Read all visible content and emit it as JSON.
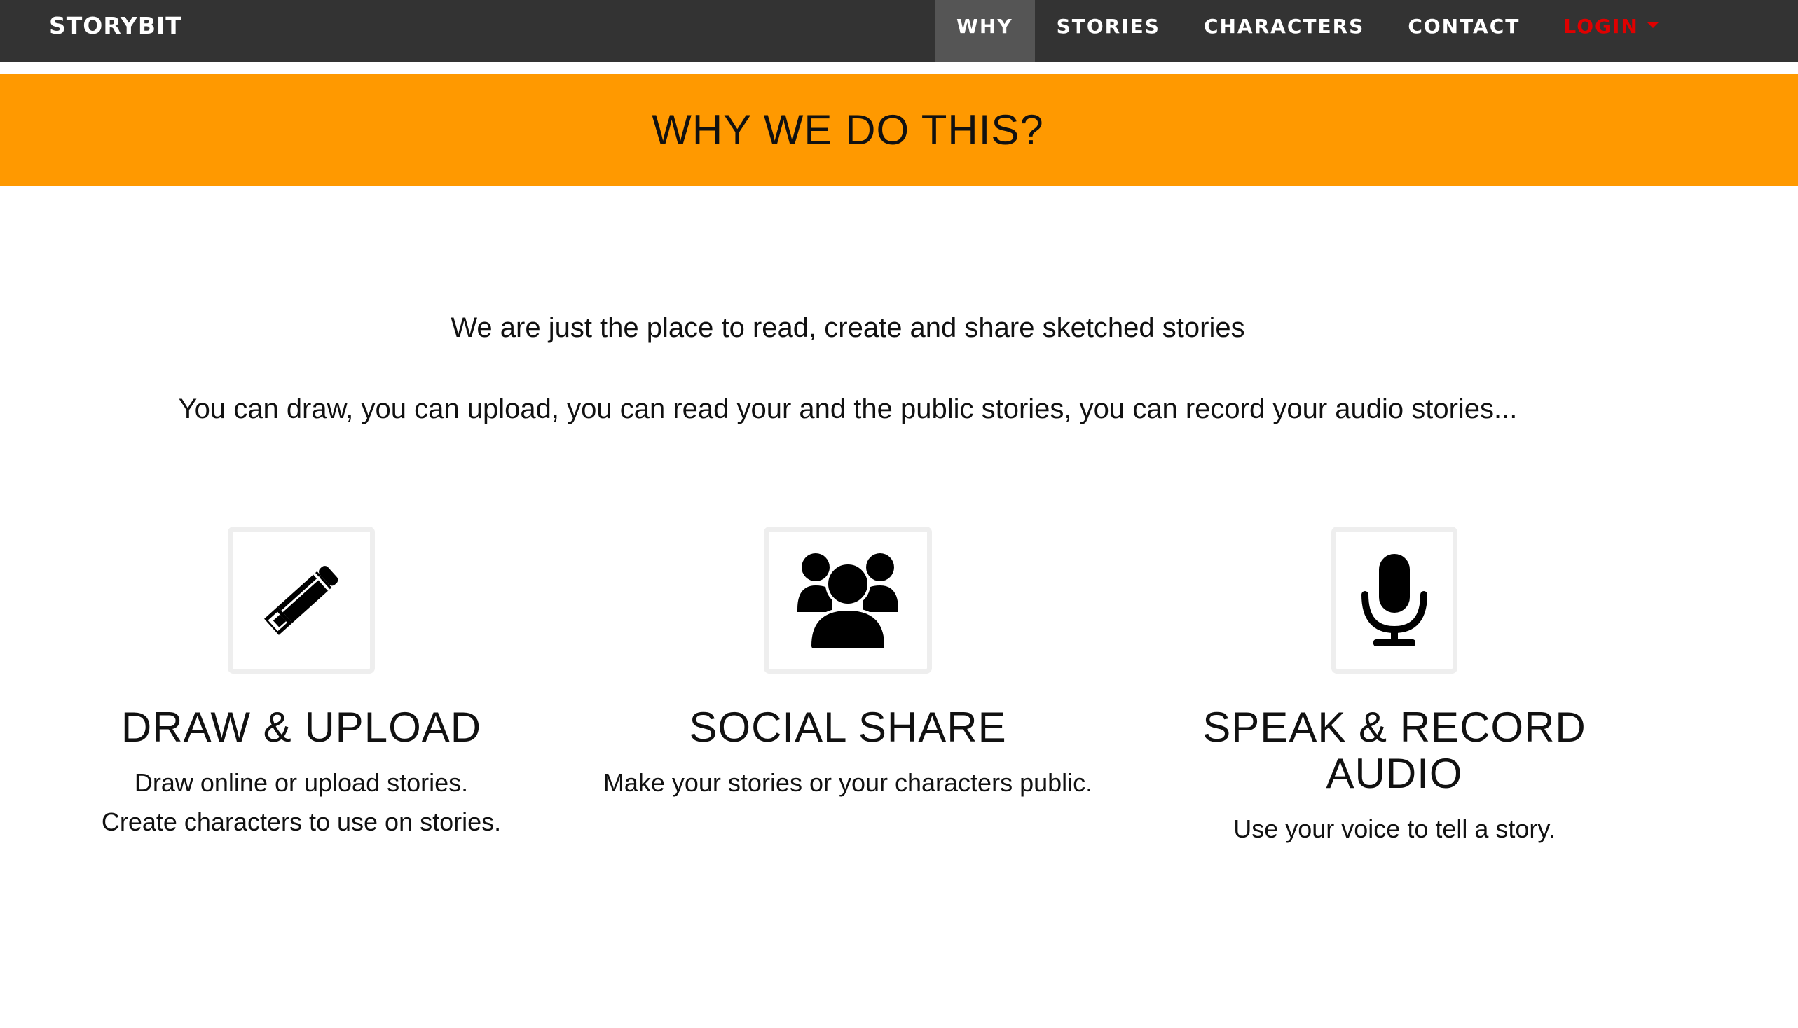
{
  "navbar": {
    "brand": "STORYBIT",
    "items": [
      {
        "label": "WHY",
        "active": true
      },
      {
        "label": "STORIES",
        "active": false
      },
      {
        "label": "CHARACTERS",
        "active": false
      },
      {
        "label": "CONTACT",
        "active": false
      }
    ],
    "login_label": "LOGIN"
  },
  "banner": {
    "title": "WHY WE DO THIS?"
  },
  "intro": {
    "line1": "We are just the place to read, create and share sketched stories",
    "line2": "You can draw, you can upload, you can read your and the public stories, you can record your audio stories..."
  },
  "features": [
    {
      "icon": "pencil-icon",
      "title": "DRAW & UPLOAD",
      "desc_lines": [
        "Draw online or upload stories.",
        "Create characters to use on stories."
      ]
    },
    {
      "icon": "users-icon",
      "title": "SOCIAL SHARE",
      "desc_lines": [
        "Make your stories or your characters public."
      ]
    },
    {
      "icon": "microphone-icon",
      "title_lines": [
        "SPEAK & RECORD",
        "AUDIO"
      ],
      "desc_lines": [
        "Use your voice to tell a story."
      ]
    }
  ],
  "colors": {
    "navbar_bg": "#333333",
    "nav_active_bg": "#555555",
    "banner_bg": "#ff9900",
    "login_text": "#e00000",
    "icon_border": "#eeeeee"
  }
}
